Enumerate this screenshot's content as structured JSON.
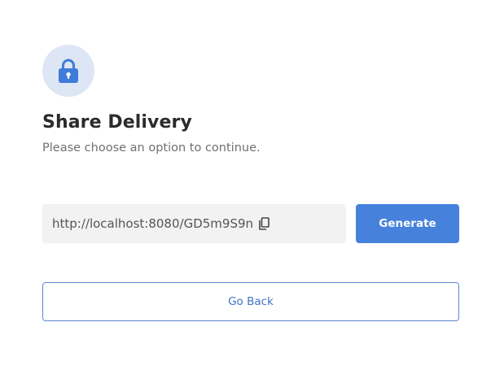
{
  "header": {
    "icon": "lock-icon",
    "title": "Share Delivery",
    "subtitle": "Please choose an option to continue."
  },
  "share_link": {
    "url": "http://localhost:8080/GD5m9S9n",
    "copy_icon": "copy-icon"
  },
  "actions": {
    "generate_label": "Generate",
    "back_label": "Go Back"
  },
  "colors": {
    "accent": "#4682db",
    "icon_bg": "#dce6f4",
    "field_bg": "#f2f2f2",
    "title": "#2b2b2b",
    "subtitle": "#6f6f6f"
  }
}
